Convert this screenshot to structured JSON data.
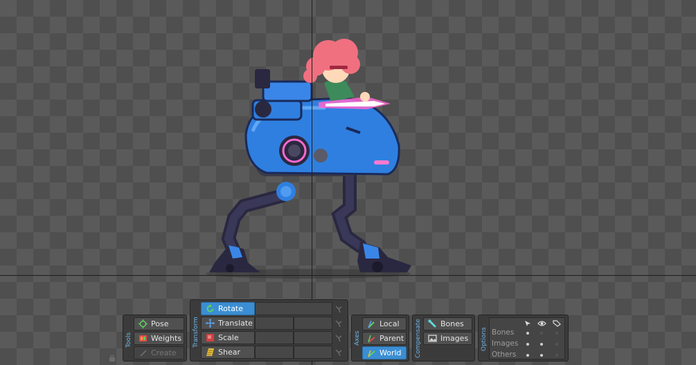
{
  "tools": {
    "label": "Tools",
    "pose": "Pose",
    "weights": "Weights",
    "create": "Create"
  },
  "transform": {
    "label": "Transform",
    "rotate": "Rotate",
    "translate": "Translate",
    "scale": "Scale",
    "shear": "Shear"
  },
  "axes": {
    "label": "Axes",
    "local": "Local",
    "parent": "Parent",
    "world": "World",
    "selected": "World"
  },
  "compensate": {
    "label": "Compensate",
    "bones": "Bones",
    "images": "Images"
  },
  "options": {
    "label": "Options",
    "rows": [
      "Bones",
      "Images",
      "Others"
    ],
    "column_icons": [
      "cursor-icon",
      "eye-icon",
      "tag-icon"
    ]
  },
  "colors": {
    "accent": "#3b8ed3",
    "label_blue": "#6fb3e6",
    "robot_blue": "#2f7fe0",
    "hair": "#f07080"
  }
}
